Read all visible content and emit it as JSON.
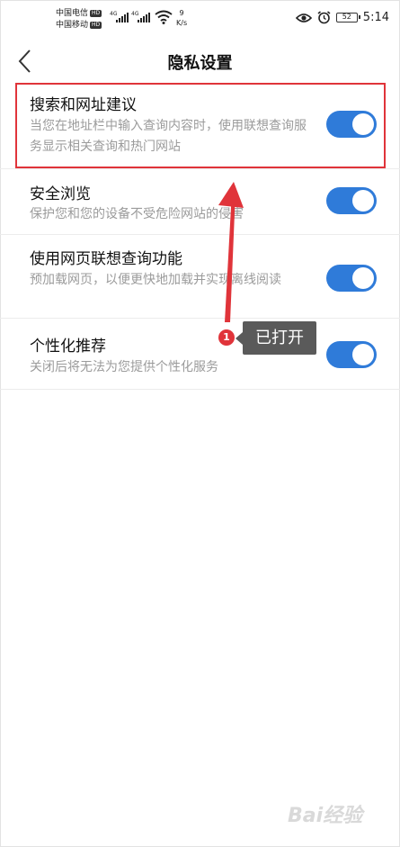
{
  "status_bar": {
    "carrier1": "中国电信",
    "carrier2": "中国移动",
    "hd_label": "HD",
    "net_label": "4G",
    "speed_value": "9",
    "speed_unit": "K/s",
    "battery": "52",
    "time": "5:14"
  },
  "header": {
    "title": "隐私设置"
  },
  "settings": [
    {
      "label": "搜索和网址建议",
      "desc": "当您在地址栏中输入查询内容时，使用联想查询服务显示相关查询和热门网站",
      "enabled": true
    },
    {
      "label": "安全浏览",
      "desc": "保护您和您的设备不受危险网站的侵害",
      "enabled": true
    },
    {
      "label": "使用网页联想查询功能",
      "desc": "预加载网页，以便更快地加载并实现离线阅读",
      "enabled": true
    },
    {
      "label": "个性化推荐",
      "desc": "关闭后将无法为您提供个性化服务",
      "enabled": true
    }
  ],
  "annotation": {
    "number": "1",
    "callout": "已打开"
  },
  "watermark": "Bai经验",
  "colors": {
    "toggle_on": "#2f7bd9",
    "highlight": "#e0343a"
  }
}
